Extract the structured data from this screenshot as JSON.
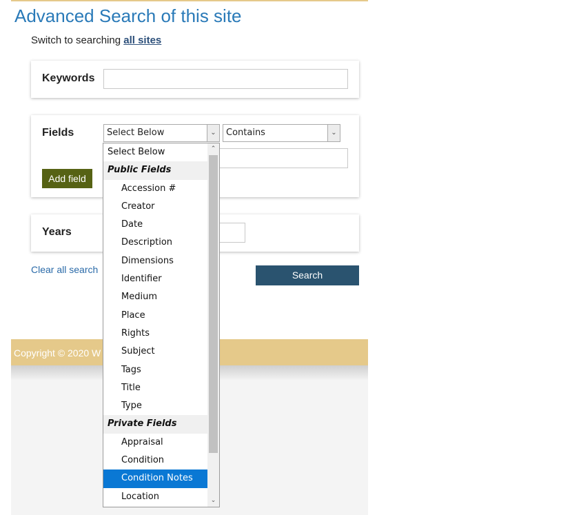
{
  "page_title": "Advanced Search of this site",
  "switch_text": "Switch to searching ",
  "switch_link": "all sites",
  "keywords": {
    "label": "Keywords",
    "value": ""
  },
  "fields": {
    "label": "Fields",
    "field_select": "Select Below",
    "operator_select": "Contains",
    "value": "",
    "add_button": "Add field"
  },
  "years": {
    "label": "Years"
  },
  "clear_link": "Clear all search",
  "search_button": "Search",
  "footer": {
    "text": "Copyright © 2020 W"
  },
  "dropdown": {
    "first_option": "Select Below",
    "groups": [
      {
        "label": "Public Fields",
        "options": [
          "Accession #",
          "Creator",
          "Date",
          "Description",
          "Dimensions",
          "Identifier",
          "Medium",
          "Place",
          "Rights",
          "Subject",
          "Tags",
          "Title",
          "Type"
        ]
      },
      {
        "label": "Private Fields",
        "options": [
          "Appraisal",
          "Condition",
          "Condition Notes",
          "Location"
        ]
      }
    ],
    "selected_option": "Condition Notes"
  },
  "icons": {
    "dropdown_arrow": "chevron-down-icon",
    "scroll_up": "chevron-up-icon",
    "scroll_down": "chevron-down-icon"
  },
  "colors": {
    "title": "#2a7ab8",
    "accent_gold": "#e5c98a",
    "add_button": "#566214",
    "search_button": "#2a536f",
    "selected": "#0a78d4"
  }
}
